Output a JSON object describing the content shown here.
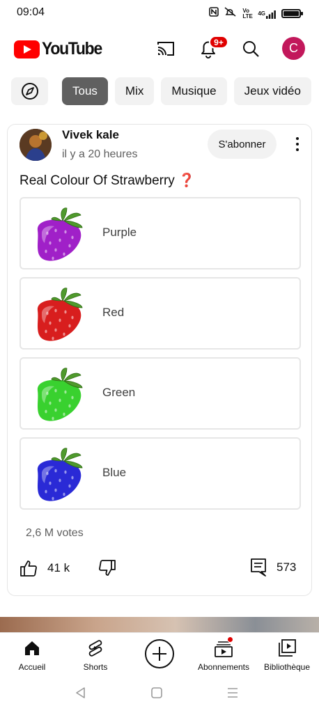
{
  "status_bar": {
    "time": "09:04",
    "icons": [
      "nfc-icon",
      "mute-icon",
      "volte-icon",
      "4g-signal-icon",
      "battery-icon"
    ],
    "volte_label": "Vo LTE",
    "network_label": "4G",
    "battery_level": 0.9
  },
  "header": {
    "logo_text": "YouTube",
    "notification_badge": "9+",
    "avatar_initial": "C",
    "avatar_color": "#c2185b"
  },
  "chips": {
    "items": [
      {
        "label": "Tous",
        "active": true
      },
      {
        "label": "Mix",
        "active": false
      },
      {
        "label": "Musique",
        "active": false
      },
      {
        "label": "Jeux vidéo",
        "active": false
      }
    ]
  },
  "post": {
    "author": "Vivek kale",
    "time_ago": "il y a 20 heures",
    "subscribe_label": "S'abonner",
    "text": "Real Colour Of Strawberry",
    "text_emoji": "❓",
    "options": [
      {
        "label": "Purple",
        "color": "#a020c8"
      },
      {
        "label": "Red",
        "color": "#d81e1e"
      },
      {
        "label": "Green",
        "color": "#39d12f"
      },
      {
        "label": "Blue",
        "color": "#2a2ad6"
      }
    ],
    "votes": "2,6 M votes",
    "likes": "41 k",
    "comments": "573"
  },
  "bottom_nav": {
    "items": [
      {
        "label": "Accueil",
        "icon": "home-icon"
      },
      {
        "label": "Shorts",
        "icon": "shorts-icon"
      },
      {
        "label": "",
        "icon": "create-icon"
      },
      {
        "label": "Abonnements",
        "icon": "subscriptions-icon"
      },
      {
        "label": "Bibliothèque",
        "icon": "library-icon"
      }
    ]
  },
  "accent_color": "#ff0000"
}
